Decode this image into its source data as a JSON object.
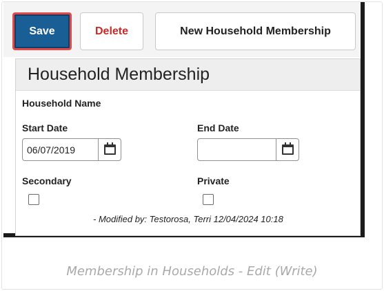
{
  "toolbar": {
    "save_label": "Save",
    "delete_label": "Delete",
    "new_label": "New Household Membership"
  },
  "panel": {
    "title": "Household Membership",
    "household_name_label": "Household Name",
    "start_date_label": "Start Date",
    "start_date_value": "06/07/2019",
    "end_date_label": "End Date",
    "end_date_value": "",
    "secondary_label": "Secondary",
    "secondary_checked": false,
    "private_label": "Private",
    "private_checked": false,
    "modified_text": "- Modified by: Testorosa, Terri 12/04/2024 10:18"
  },
  "icons": {
    "calendar": "calendar-icon"
  },
  "colors": {
    "save_bg": "#1a5e96",
    "save_highlight": "#e24a4a",
    "delete_text": "#c52b27"
  },
  "caption": "Membership in Households - Edit (Write)"
}
